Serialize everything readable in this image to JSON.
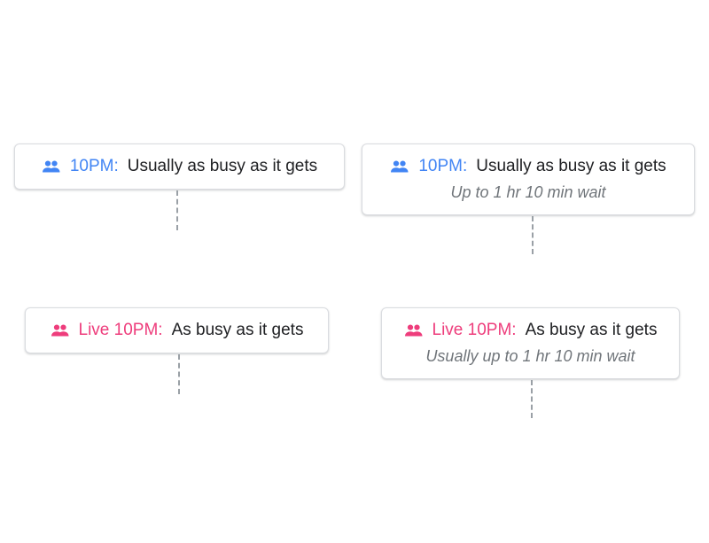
{
  "colors": {
    "historical": "#4285f4",
    "live": "#ee3d7c",
    "text": "#202124",
    "subtext": "#70757a"
  },
  "cards": [
    {
      "icon": "people-icon",
      "time_label": "10PM:",
      "status": "Usually as busy as it gets"
    },
    {
      "icon": "people-icon",
      "time_label": "10PM:",
      "status": "Usually as busy as it gets",
      "wait": "Up to 1 hr 10 min wait"
    },
    {
      "icon": "people-icon",
      "time_label": "Live 10PM:",
      "status": "As busy as it gets"
    },
    {
      "icon": "people-icon",
      "time_label": "Live 10PM:",
      "status": "As busy as it gets",
      "wait": "Usually up to 1 hr 10 min wait"
    }
  ]
}
